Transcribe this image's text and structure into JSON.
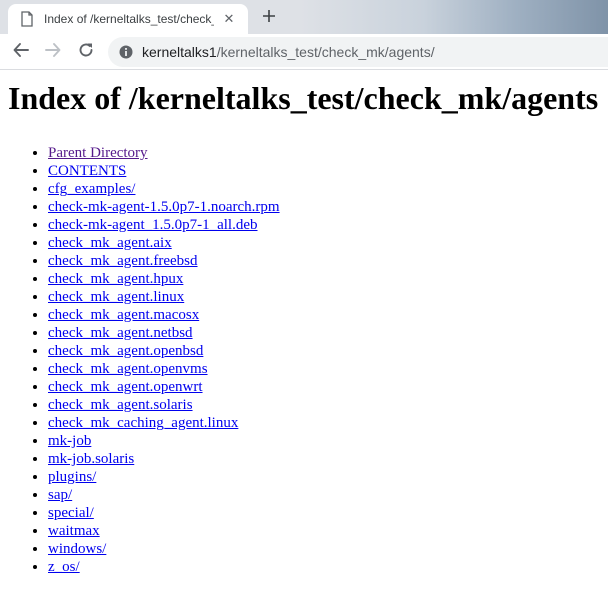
{
  "browser": {
    "tab": {
      "title": "Index of /kerneltalks_test/check_mk",
      "close_glyph": "✕"
    },
    "icons": {
      "favicon": "document-icon",
      "close": "close-icon",
      "new_tab": "plus-icon",
      "back": "back-arrow-icon",
      "forward": "forward-arrow-icon",
      "reload": "reload-icon",
      "site_info": "site-info-icon"
    },
    "address": {
      "host": "kerneltalks1",
      "path": "/kerneltalks_test/check_mk/agents/"
    }
  },
  "page": {
    "heading": "Index of /kerneltalks_test/check_mk/agents",
    "link_color": "#0000ee",
    "visited_color": "#551a8b",
    "entries": [
      {
        "label": "Parent Directory",
        "visited": true
      },
      {
        "label": "CONTENTS",
        "visited": false
      },
      {
        "label": "cfg_examples/",
        "visited": false
      },
      {
        "label": "check-mk-agent-1.5.0p7-1.noarch.rpm",
        "visited": false
      },
      {
        "label": "check-mk-agent_1.5.0p7-1_all.deb",
        "visited": false
      },
      {
        "label": "check_mk_agent.aix",
        "visited": false
      },
      {
        "label": "check_mk_agent.freebsd",
        "visited": false
      },
      {
        "label": "check_mk_agent.hpux",
        "visited": false
      },
      {
        "label": "check_mk_agent.linux",
        "visited": false
      },
      {
        "label": "check_mk_agent.macosx",
        "visited": false
      },
      {
        "label": "check_mk_agent.netbsd",
        "visited": false
      },
      {
        "label": "check_mk_agent.openbsd",
        "visited": false
      },
      {
        "label": "check_mk_agent.openvms",
        "visited": false
      },
      {
        "label": "check_mk_agent.openwrt",
        "visited": false
      },
      {
        "label": "check_mk_agent.solaris",
        "visited": false
      },
      {
        "label": "check_mk_caching_agent.linux",
        "visited": false
      },
      {
        "label": "mk-job",
        "visited": false
      },
      {
        "label": "mk-job.solaris",
        "visited": false
      },
      {
        "label": "plugins/",
        "visited": false
      },
      {
        "label": "sap/",
        "visited": false
      },
      {
        "label": "special/",
        "visited": false
      },
      {
        "label": "waitmax",
        "visited": false
      },
      {
        "label": "windows/",
        "visited": false
      },
      {
        "label": "z_os/",
        "visited": false
      }
    ]
  }
}
